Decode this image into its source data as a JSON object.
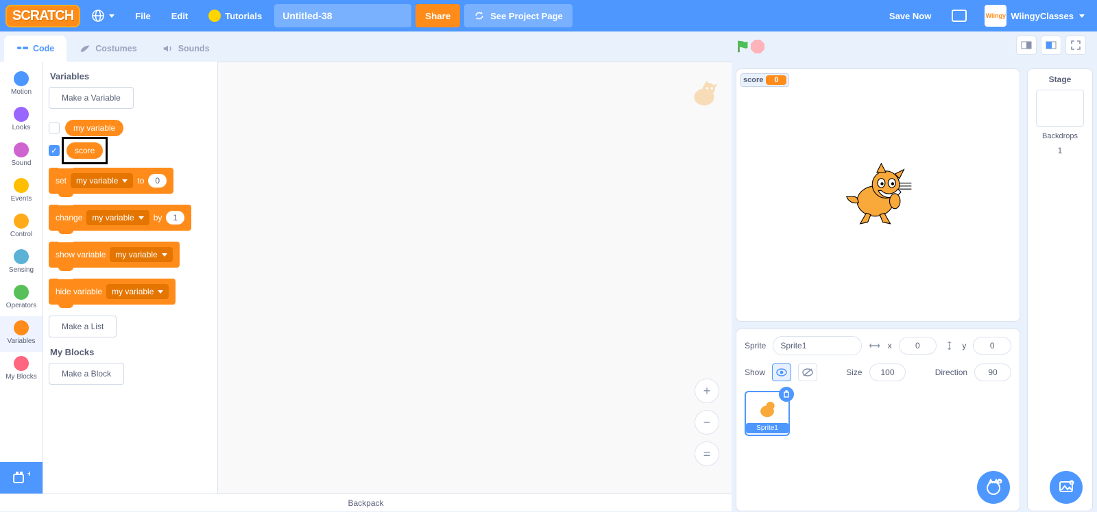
{
  "menu": {
    "logo": "SCRATCH",
    "file": "File",
    "edit": "Edit",
    "tutorials": "Tutorials",
    "project_name": "Untitled-38",
    "share": "Share",
    "see_page": "See Project Page",
    "save_now": "Save Now",
    "user": "WiingyClasses",
    "user_logo": "Wiingy"
  },
  "tabs": {
    "code": "Code",
    "costumes": "Costumes",
    "sounds": "Sounds"
  },
  "categories": [
    {
      "name": "Motion",
      "color": "#4c97ff"
    },
    {
      "name": "Looks",
      "color": "#9966ff"
    },
    {
      "name": "Sound",
      "color": "#cf63cf"
    },
    {
      "name": "Events",
      "color": "#ffbf00"
    },
    {
      "name": "Control",
      "color": "#ffab19"
    },
    {
      "name": "Sensing",
      "color": "#5cb1d6"
    },
    {
      "name": "Operators",
      "color": "#59c059"
    },
    {
      "name": "Variables",
      "color": "#ff8c1a"
    },
    {
      "name": "My Blocks",
      "color": "#ff6680"
    }
  ],
  "selected_category": "Variables",
  "palette": {
    "variables_header": "Variables",
    "make_variable": "Make a Variable",
    "vars": [
      {
        "name": "my variable",
        "checked": false
      },
      {
        "name": "score",
        "checked": true,
        "highlight": true
      }
    ],
    "blocks": {
      "set": {
        "label_a": "set",
        "dd": "my variable",
        "label_b": "to",
        "val": "0"
      },
      "change": {
        "label_a": "change",
        "dd": "my variable",
        "label_b": "by",
        "val": "1"
      },
      "show": {
        "label_a": "show variable",
        "dd": "my variable"
      },
      "hide": {
        "label_a": "hide variable",
        "dd": "my variable"
      }
    },
    "make_list": "Make a List",
    "myblocks_header": "My Blocks",
    "make_block": "Make a Block"
  },
  "stage": {
    "variable_monitor": {
      "name": "score",
      "value": "0"
    }
  },
  "sprite_info": {
    "sprite_label": "Sprite",
    "sprite_name": "Sprite1",
    "x_label": "x",
    "x": "0",
    "y_label": "y",
    "y": "0",
    "show_label": "Show",
    "size_label": "Size",
    "size": "100",
    "direction_label": "Direction",
    "direction": "90",
    "tile_label": "Sprite1"
  },
  "stage_panel": {
    "title": "Stage",
    "backdrops_label": "Backdrops",
    "backdrops_count": "1"
  },
  "backpack": "Backpack",
  "zoom": {
    "in": "+",
    "out": "−",
    "eq": "="
  }
}
